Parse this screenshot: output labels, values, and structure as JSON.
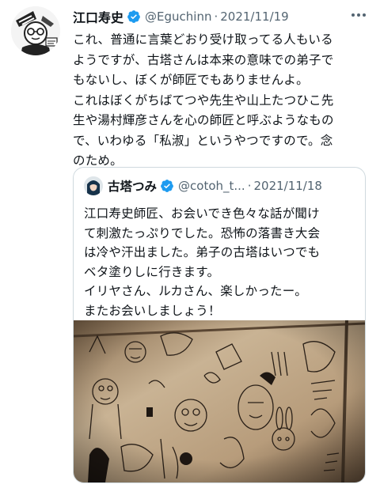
{
  "tweet": {
    "author_name": "江口寿史",
    "handle": "@Eguchinn",
    "separator": "·",
    "date": "2021/11/19",
    "text": "これ、普通に言葉どおり受け取ってる人もいる\nようですが、古塔さんは本来の意味での弟子で\nもないし、ぼくが師匠でもありませんよ。\nこれはぼくがちばてつや先生や山上たつひこ先\n生や湯村輝彦さんを心の師匠と呼ぶようなもの\nで、いわゆる「私淑」というやつですので。念\nのため。",
    "verified": true
  },
  "quoted": {
    "author_name": "古塔つみ",
    "handle": "@cotoh_t...",
    "separator": "·",
    "date": "2021/11/18",
    "text": "江口寿史師匠、お会いでき色々な話が聞け\nて刺激たっぷりでした。恐怖の落書き大会\nは冷や汗出ました。弟子の古塔はいつでも\nベタ塗りしに行きます。\nイリヤさん、ルカさん、楽しかったー。\nまたお会いしましょう！",
    "verified": true
  },
  "colors": {
    "verified_blue": "#1d9bf0",
    "secondary_text": "#536471",
    "border": "#cfd9de",
    "wall_base": "#b89e7e"
  },
  "icons": [
    "verified-badge-icon",
    "more-icon"
  ]
}
